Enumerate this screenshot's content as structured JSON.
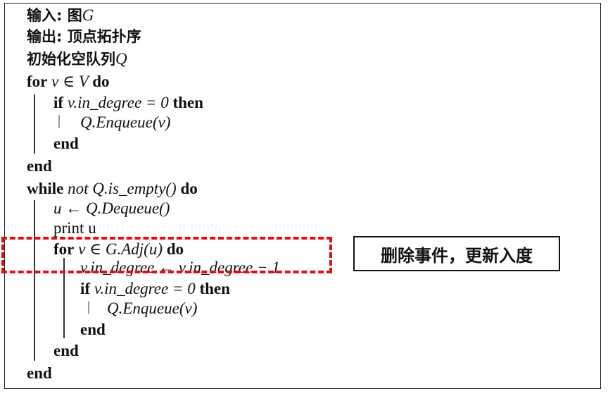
{
  "algorithm": {
    "input": {
      "label": "输入: 图",
      "var": "G"
    },
    "output": {
      "label": "输出: 顶点拓扑序"
    },
    "init": {
      "label": "初始化空队列",
      "var": "Q"
    },
    "lines": [
      {
        "kw": "for",
        "math": " v ∈ V ",
        "kw2": "do"
      },
      {
        "kw": "if",
        "math": " v.in_degree = 0 ",
        "kw2": "then"
      },
      {
        "kw": "",
        "math": "Q.Enqueue(v)",
        "kw2": ""
      },
      {
        "kw": "end",
        "math": "",
        "kw2": ""
      },
      {
        "kw": "end",
        "math": "",
        "kw2": ""
      },
      {
        "kw": "while",
        "math": " not Q.is_empty() ",
        "kw2": "do"
      },
      {
        "kw": "",
        "math": "u ← Q.Dequeue()",
        "kw2": ""
      },
      {
        "kw": "",
        "math": "print u",
        "kw2": ""
      },
      {
        "kw": "for",
        "math": " v ∈ G.Adj(u) ",
        "kw2": "do"
      },
      {
        "kw": "",
        "math": "v.in_degree ← v.in_degree − 1",
        "kw2": ""
      },
      {
        "kw": "if",
        "math": " v.in_degree = 0 ",
        "kw2": "then"
      },
      {
        "kw": "",
        "math": "Q.Enqueue(v)",
        "kw2": ""
      },
      {
        "kw": "end",
        "math": "",
        "kw2": ""
      },
      {
        "kw": "end",
        "math": "",
        "kw2": ""
      },
      {
        "kw": "end",
        "math": "",
        "kw2": ""
      }
    ]
  },
  "annotation": {
    "text": "删除事件，更新入度",
    "highlight_color": "#e01010"
  }
}
